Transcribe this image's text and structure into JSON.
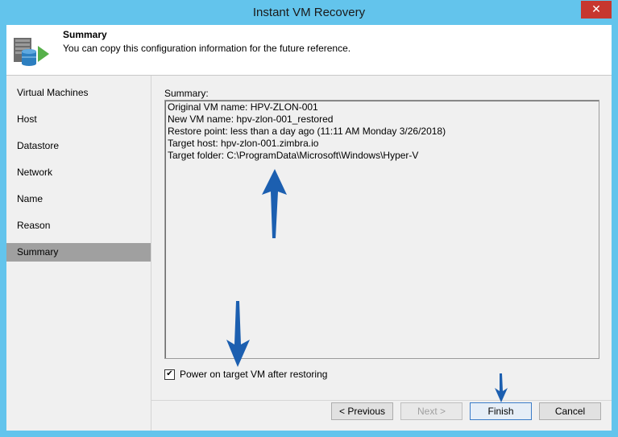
{
  "window": {
    "title": "Instant VM Recovery",
    "close_glyph": "✕"
  },
  "header": {
    "title": "Summary",
    "subtitle": "You can copy this configuration information for the future reference.",
    "icon": "server-restore-icon"
  },
  "sidebar": {
    "items": [
      {
        "label": "Virtual Machines",
        "active": false
      },
      {
        "label": "Host",
        "active": false
      },
      {
        "label": "Datastore",
        "active": false
      },
      {
        "label": "Network",
        "active": false
      },
      {
        "label": "Name",
        "active": false
      },
      {
        "label": "Reason",
        "active": false
      },
      {
        "label": "Summary",
        "active": true
      }
    ]
  },
  "summary": {
    "label": "Summary:",
    "lines": [
      "Original VM name: HPV-ZLON-001",
      "New VM name: hpv-zlon-001_restored",
      "Restore point: less than a day ago (11:11 AM Monday 3/26/2018)",
      "Target host: hpv-zlon-001.zimbra.io",
      "Target folder: C:\\ProgramData\\Microsoft\\Windows\\Hyper-V"
    ]
  },
  "power_on": {
    "label": "Power on target VM after restoring",
    "checked": true
  },
  "buttons": {
    "previous": "< Previous",
    "next": "Next >",
    "finish": "Finish",
    "cancel": "Cancel"
  },
  "colors": {
    "titlebar": "#63c4ec",
    "close": "#c7372f",
    "annotation_arrow": "#1c5fb0",
    "active_nav": "#a0a0a0"
  }
}
